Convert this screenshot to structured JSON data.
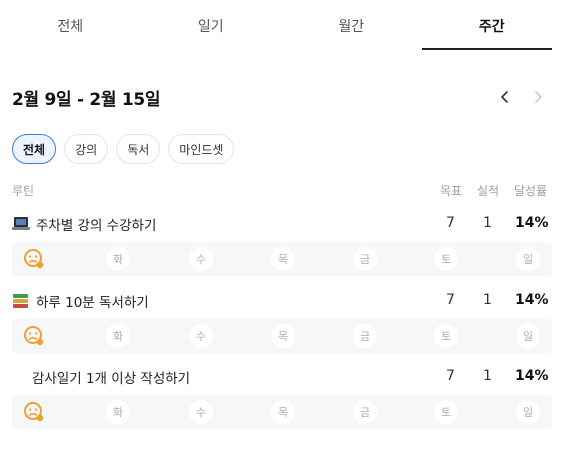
{
  "tabs": [
    {
      "label": "전체",
      "active": false
    },
    {
      "label": "일기",
      "active": false
    },
    {
      "label": "월간",
      "active": false
    },
    {
      "label": "주간",
      "active": true
    }
  ],
  "week": {
    "title": "2월 9일 - 2월 15일",
    "prev_icon": "chevron-left-icon",
    "next_icon": "chevron-right-icon"
  },
  "filters": [
    {
      "label": "전체",
      "active": true
    },
    {
      "label": "강의",
      "active": false
    },
    {
      "label": "독서",
      "active": false
    },
    {
      "label": "마인드셋",
      "active": false
    }
  ],
  "columns": {
    "routine": "루틴",
    "goal": "목표",
    "actual": "실적",
    "rate": "달성률"
  },
  "routines": [
    {
      "icon": "laptop-icon",
      "name": "주차별 강의 수강하기",
      "goal": "7",
      "actual": "1",
      "rate": "14%",
      "days": [
        "화",
        "수",
        "목",
        "금",
        "토",
        "일"
      ]
    },
    {
      "icon": "books-icon",
      "name": "하루 10분 독서하기",
      "goal": "7",
      "actual": "1",
      "rate": "14%",
      "days": [
        "화",
        "수",
        "목",
        "금",
        "토",
        "일"
      ]
    },
    {
      "icon": "",
      "name": "감사일기 1개 이상 작성하기",
      "goal": "7",
      "actual": "1",
      "rate": "14%",
      "days": [
        "화",
        "수",
        "목",
        "금",
        "토",
        "일"
      ]
    }
  ],
  "colors": {
    "accent": "#3d7be8",
    "face_orange": "#f0a030",
    "day_bg": "#f6f7f9"
  }
}
